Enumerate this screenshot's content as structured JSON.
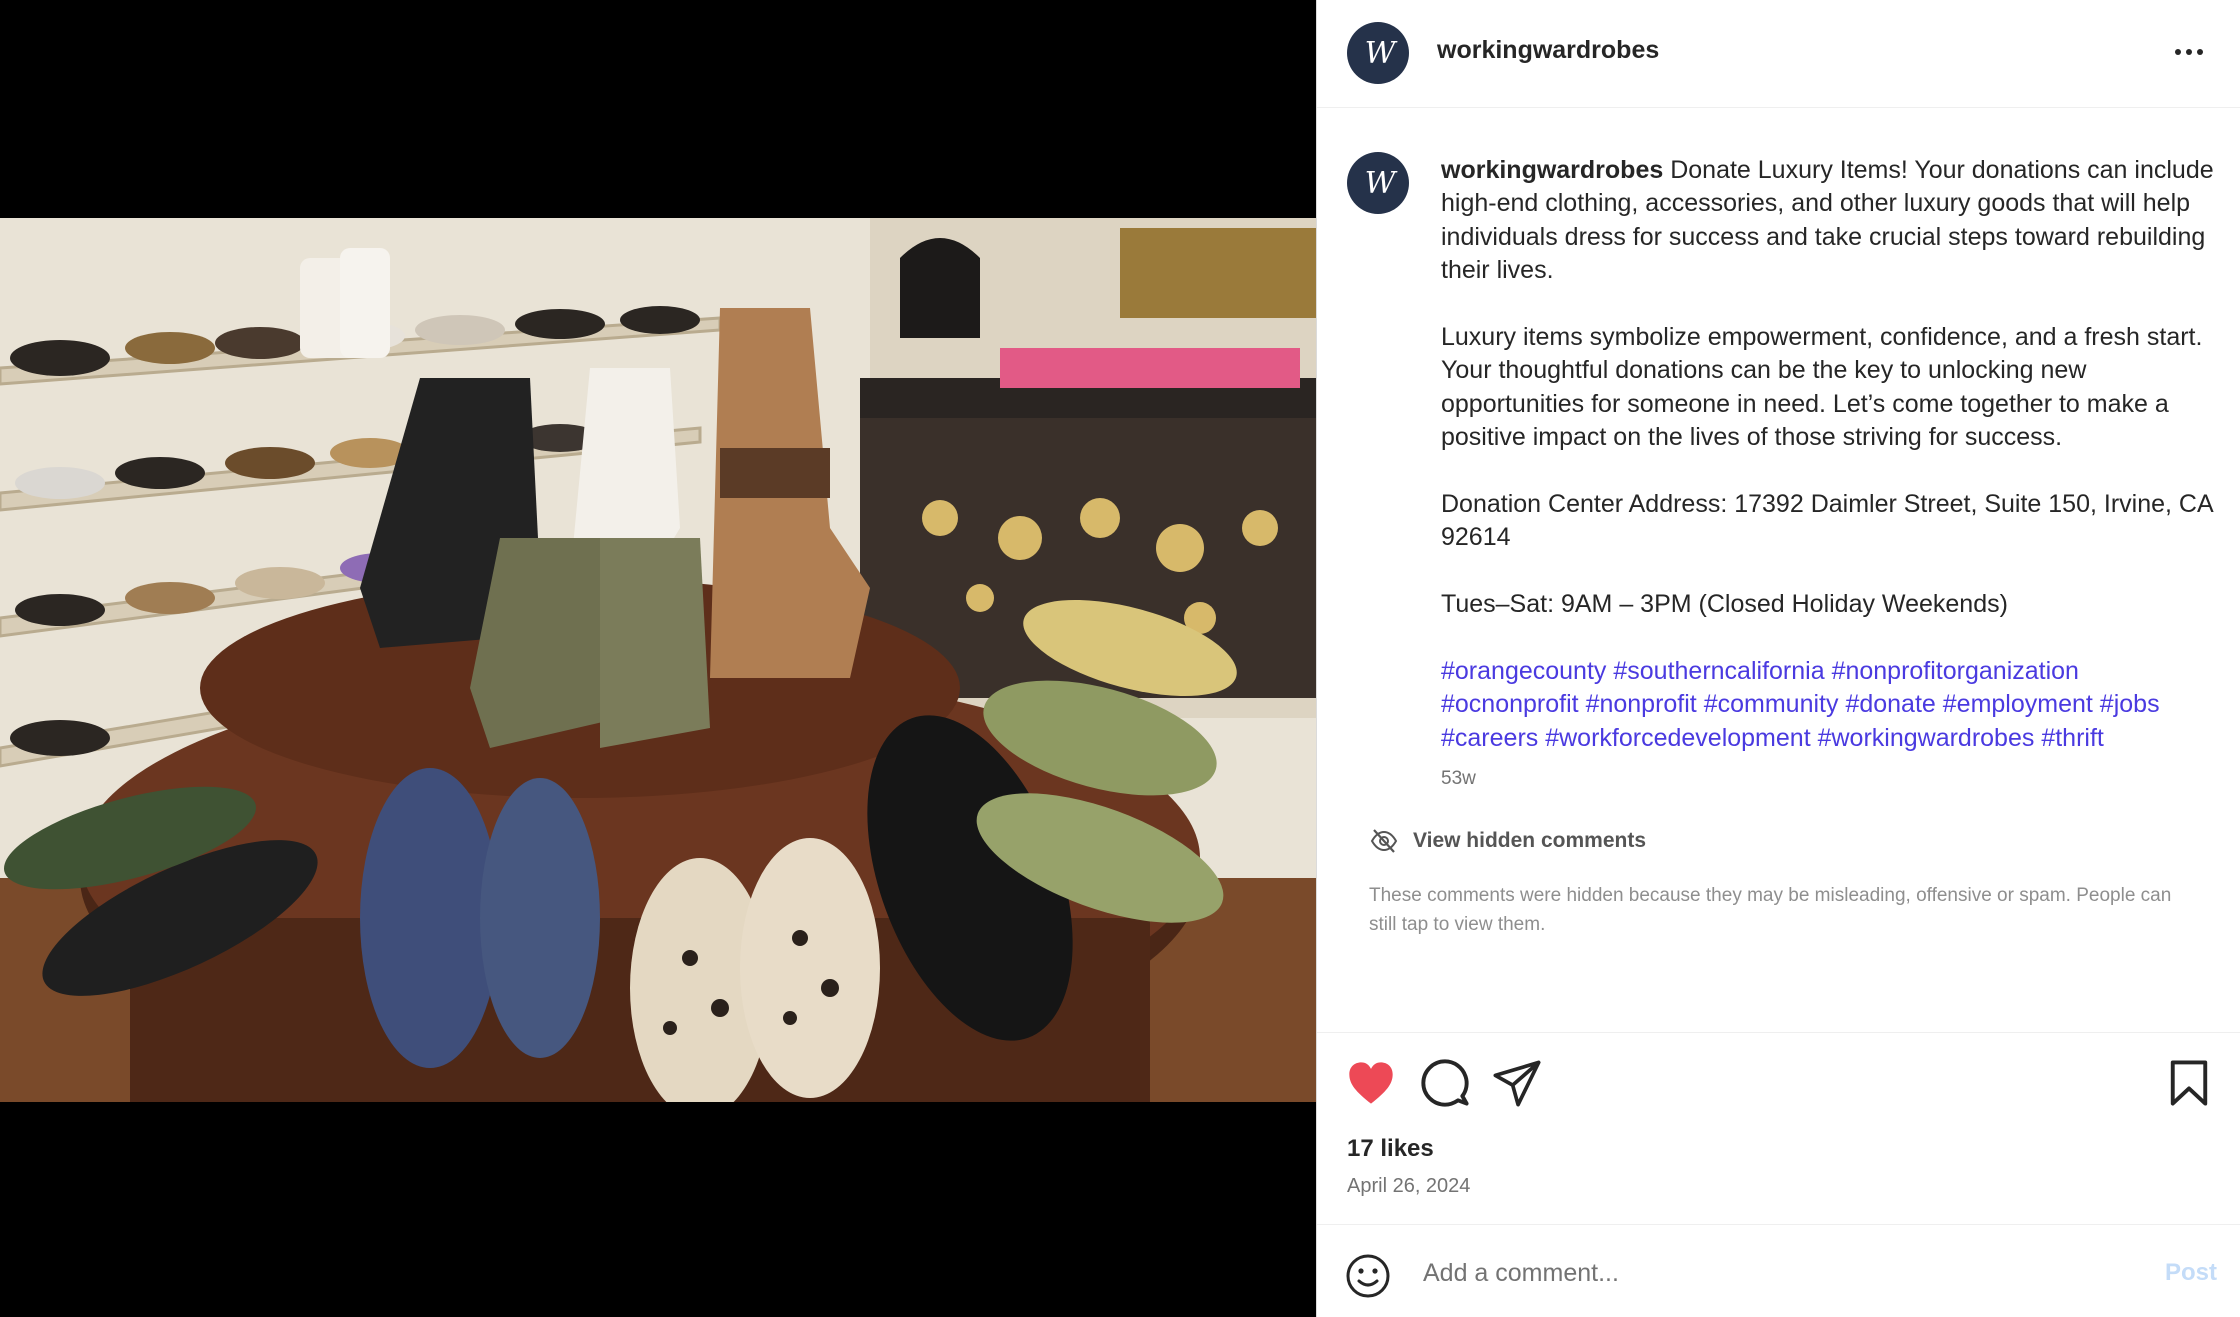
{
  "post": {
    "username": "workingwardrobes",
    "avatar_text": "W",
    "caption_lead": "Donate Luxury Items! Your donations can include high-end clothing, accessories, and other luxury goods that will help individuals dress for success and take crucial steps toward rebuilding their lives.",
    "caption_p2": "Luxury items symbolize empowerment, confidence, and a fresh start. Your thoughtful donations can be the key to unlocking new opportunities for someone in need. Let’s come together to make a positive impact on the lives of those striving for success.",
    "caption_p3": "Donation Center Address: 17392 Daimler Street, Suite 150, Irvine, CA 92614",
    "caption_p4": "Tues–Sat: 9AM – 3PM (Closed Holiday Weekends)",
    "hashtags": [
      "#orangecounty",
      "#southerncalifornia",
      "#nonprofitorganization",
      "#ocnonprofit",
      "#nonprofit",
      "#community",
      "#donate",
      "#employment",
      "#jobs",
      "#careers",
      "#workforcedevelopment",
      "#workingwardrobes",
      "#thrift"
    ],
    "time_ago": "53w",
    "hidden_comments_label": "View hidden comments",
    "hidden_comments_note": "These comments were hidden because they may be misleading, offensive or spam. People can still tap to view them.",
    "likes": "17 likes",
    "date": "April 26, 2024",
    "liked": true,
    "comment_placeholder": "Add a comment...",
    "post_button": "Post"
  },
  "icons": {
    "more": "more-options-icon",
    "like": "heart-filled-icon",
    "comment": "comment-bubble-icon",
    "share": "paper-plane-icon",
    "save": "bookmark-icon",
    "hidden": "eye-slash-icon",
    "emoji": "emoji-smiley-icon"
  },
  "colors": {
    "heart": "#ed4956",
    "hashtag": "#4a3ae0",
    "avatar": "#25324a",
    "post_disabled": "#c4dcf8"
  }
}
